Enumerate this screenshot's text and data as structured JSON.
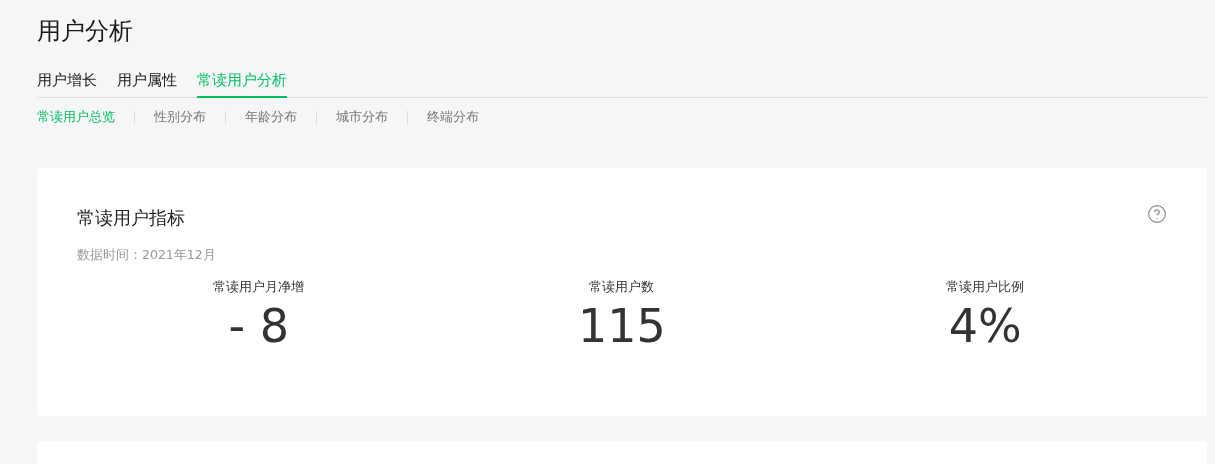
{
  "page_title": "用户分析",
  "tabs": [
    {
      "label": "用户增长",
      "selected": false
    },
    {
      "label": "用户属性",
      "selected": false
    },
    {
      "label": "常读用户分析",
      "selected": true
    }
  ],
  "subtabs": [
    {
      "label": "常读用户总览",
      "selected": true
    },
    {
      "label": "性别分布",
      "selected": false
    },
    {
      "label": "年龄分布",
      "selected": false
    },
    {
      "label": "城市分布",
      "selected": false
    },
    {
      "label": "终端分布",
      "selected": false
    }
  ],
  "card": {
    "title": "常读用户指标",
    "data_time": "数据时间：2021年12月",
    "metrics": [
      {
        "label": "常读用户月净增",
        "value": "- 8"
      },
      {
        "label": "常读用户数",
        "value": "115"
      },
      {
        "label": "常读用户比例",
        "value": "4%"
      }
    ]
  }
}
